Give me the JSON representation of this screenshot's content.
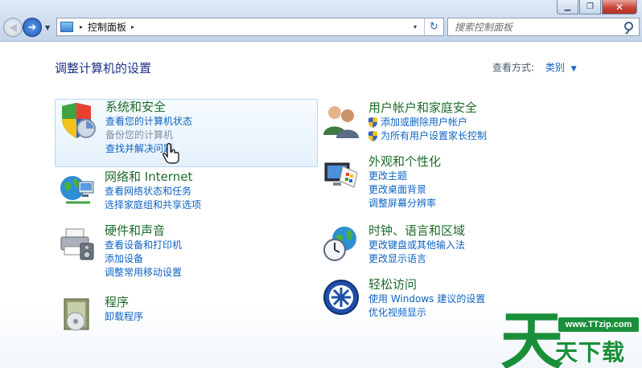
{
  "window": {
    "minimize_glyph": "▁",
    "maximize_glyph": "❐",
    "close_glyph": "✕"
  },
  "address_bar": {
    "breadcrumb": "控制面板",
    "separator": "▸",
    "dropdown_glyph": "▾",
    "refresh_glyph": "↻"
  },
  "search": {
    "placeholder": "搜索控制面板"
  },
  "header": {
    "title": "调整计算机的设置",
    "view_by_label": "查看方式:",
    "view_by_value": "类别",
    "view_by_caret": "▼"
  },
  "categories": {
    "system_security": {
      "title": "系统和安全",
      "links": [
        "查看您的计算机状态",
        "备份您的计算机",
        "查找并解决问题"
      ]
    },
    "network": {
      "title": "网络和 Internet",
      "links": [
        "查看网络状态和任务",
        "选择家庭组和共享选项"
      ]
    },
    "hardware": {
      "title": "硬件和声音",
      "links": [
        "查看设备和打印机",
        "添加设备",
        "调整常用移动设置"
      ]
    },
    "programs": {
      "title": "程序",
      "links": [
        "卸载程序"
      ]
    },
    "user_accounts": {
      "title": "用户帐户和家庭安全",
      "links": [
        "添加或删除用户帐户",
        "为所有用户设置家长控制"
      ]
    },
    "appearance": {
      "title": "外观和个性化",
      "links": [
        "更改主题",
        "更改桌面背景",
        "调整屏幕分辨率"
      ]
    },
    "clock": {
      "title": "时钟、语言和区域",
      "links": [
        "更改键盘或其他输入法",
        "更改显示语言"
      ]
    },
    "ease": {
      "title": "轻松访问",
      "links": [
        "使用 Windows 建议的设置",
        "优化视频显示"
      ]
    }
  },
  "watermark": {
    "url": "www.TTzip.com",
    "text": "天下载",
    "big_char": "天"
  },
  "colors": {
    "category_title": "#1e6b2c",
    "link": "#0e63c4",
    "page_title": "#1e3287",
    "watermark": "#1a8f3a"
  }
}
